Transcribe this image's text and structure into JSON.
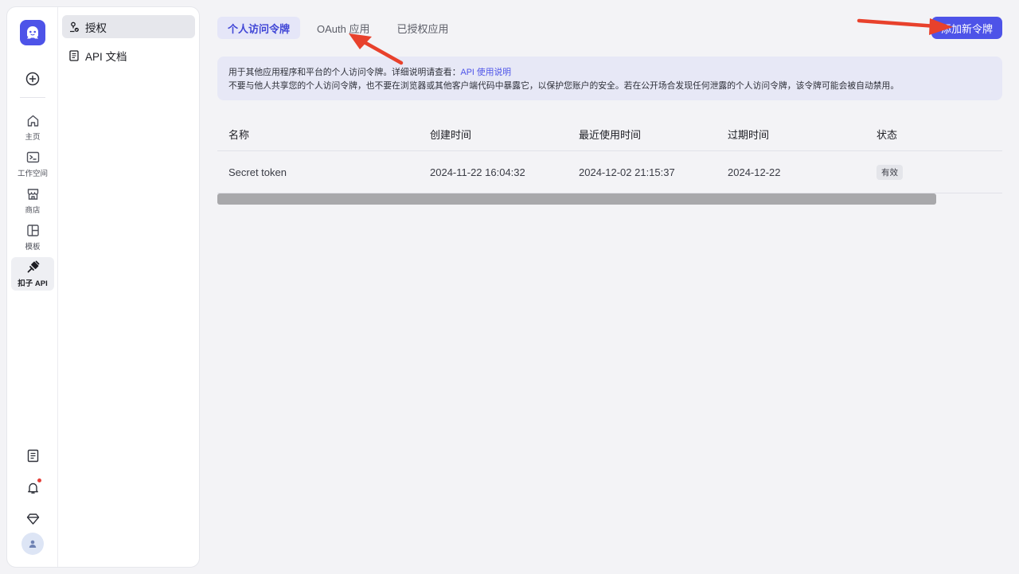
{
  "rail": {
    "nav": [
      {
        "label": "主页",
        "icon": "home-icon"
      },
      {
        "label": "工作空间",
        "icon": "terminal-icon"
      },
      {
        "label": "商店",
        "icon": "store-icon"
      },
      {
        "label": "模板",
        "icon": "template-icon"
      },
      {
        "label": "扣子 API",
        "icon": "api-plug-icon",
        "active": true
      }
    ],
    "bottom_icons": [
      "document-icon",
      "bell-icon",
      "diamond-icon",
      "avatar-icon"
    ]
  },
  "sidebar": {
    "items": [
      {
        "label": "授权",
        "icon": "authorization-icon",
        "active": true
      },
      {
        "label": "API 文档",
        "icon": "doc-icon"
      }
    ]
  },
  "tabs": [
    {
      "label": "个人访问令牌",
      "active": true
    },
    {
      "label": "OAuth 应用"
    },
    {
      "label": "已授权应用"
    }
  ],
  "add_button": {
    "label": "添加新令牌"
  },
  "notice": {
    "line1": "用于其他应用程序和平台的个人访问令牌。详细说明请查看：",
    "link": "API 使用说明",
    "line2": "不要与他人共享您的个人访问令牌，也不要在浏览器或其他客户端代码中暴露它，以保护您账户的安全。若在公开场合发现任何泄露的个人访问令牌，该令牌可能会被自动禁用。"
  },
  "table": {
    "headers": [
      "名称",
      "创建时间",
      "最近使用时间",
      "过期时间",
      "状态"
    ],
    "rows": [
      {
        "name": "Secret token",
        "created": "2024-11-22 16:04:32",
        "last_used": "2024-12-02 21:15:37",
        "expires": "2024-12-22",
        "status": "有效"
      }
    ]
  },
  "colors": {
    "accent": "#4d53e8",
    "annotation_arrow": "#e8412c",
    "notify": "#e5403a"
  }
}
